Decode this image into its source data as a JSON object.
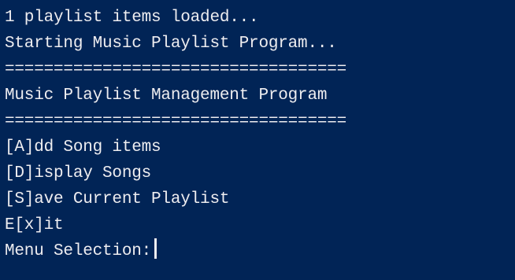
{
  "console": {
    "background": "#012456",
    "foreground": "#eeedf0",
    "lines": {
      "loaded_status": "1 playlist items loaded...",
      "starting_status": "Starting Music Playlist Program...",
      "divider_top": "===================================",
      "program_title": "Music Playlist Management Program",
      "divider_bottom": "===================================",
      "menu_add": "[A]dd Song items",
      "menu_display": "[D]isplay Songs",
      "menu_save": "[S]ave Current Playlist",
      "menu_exit": "E[x]it",
      "prompt": "Menu Selection:"
    }
  }
}
